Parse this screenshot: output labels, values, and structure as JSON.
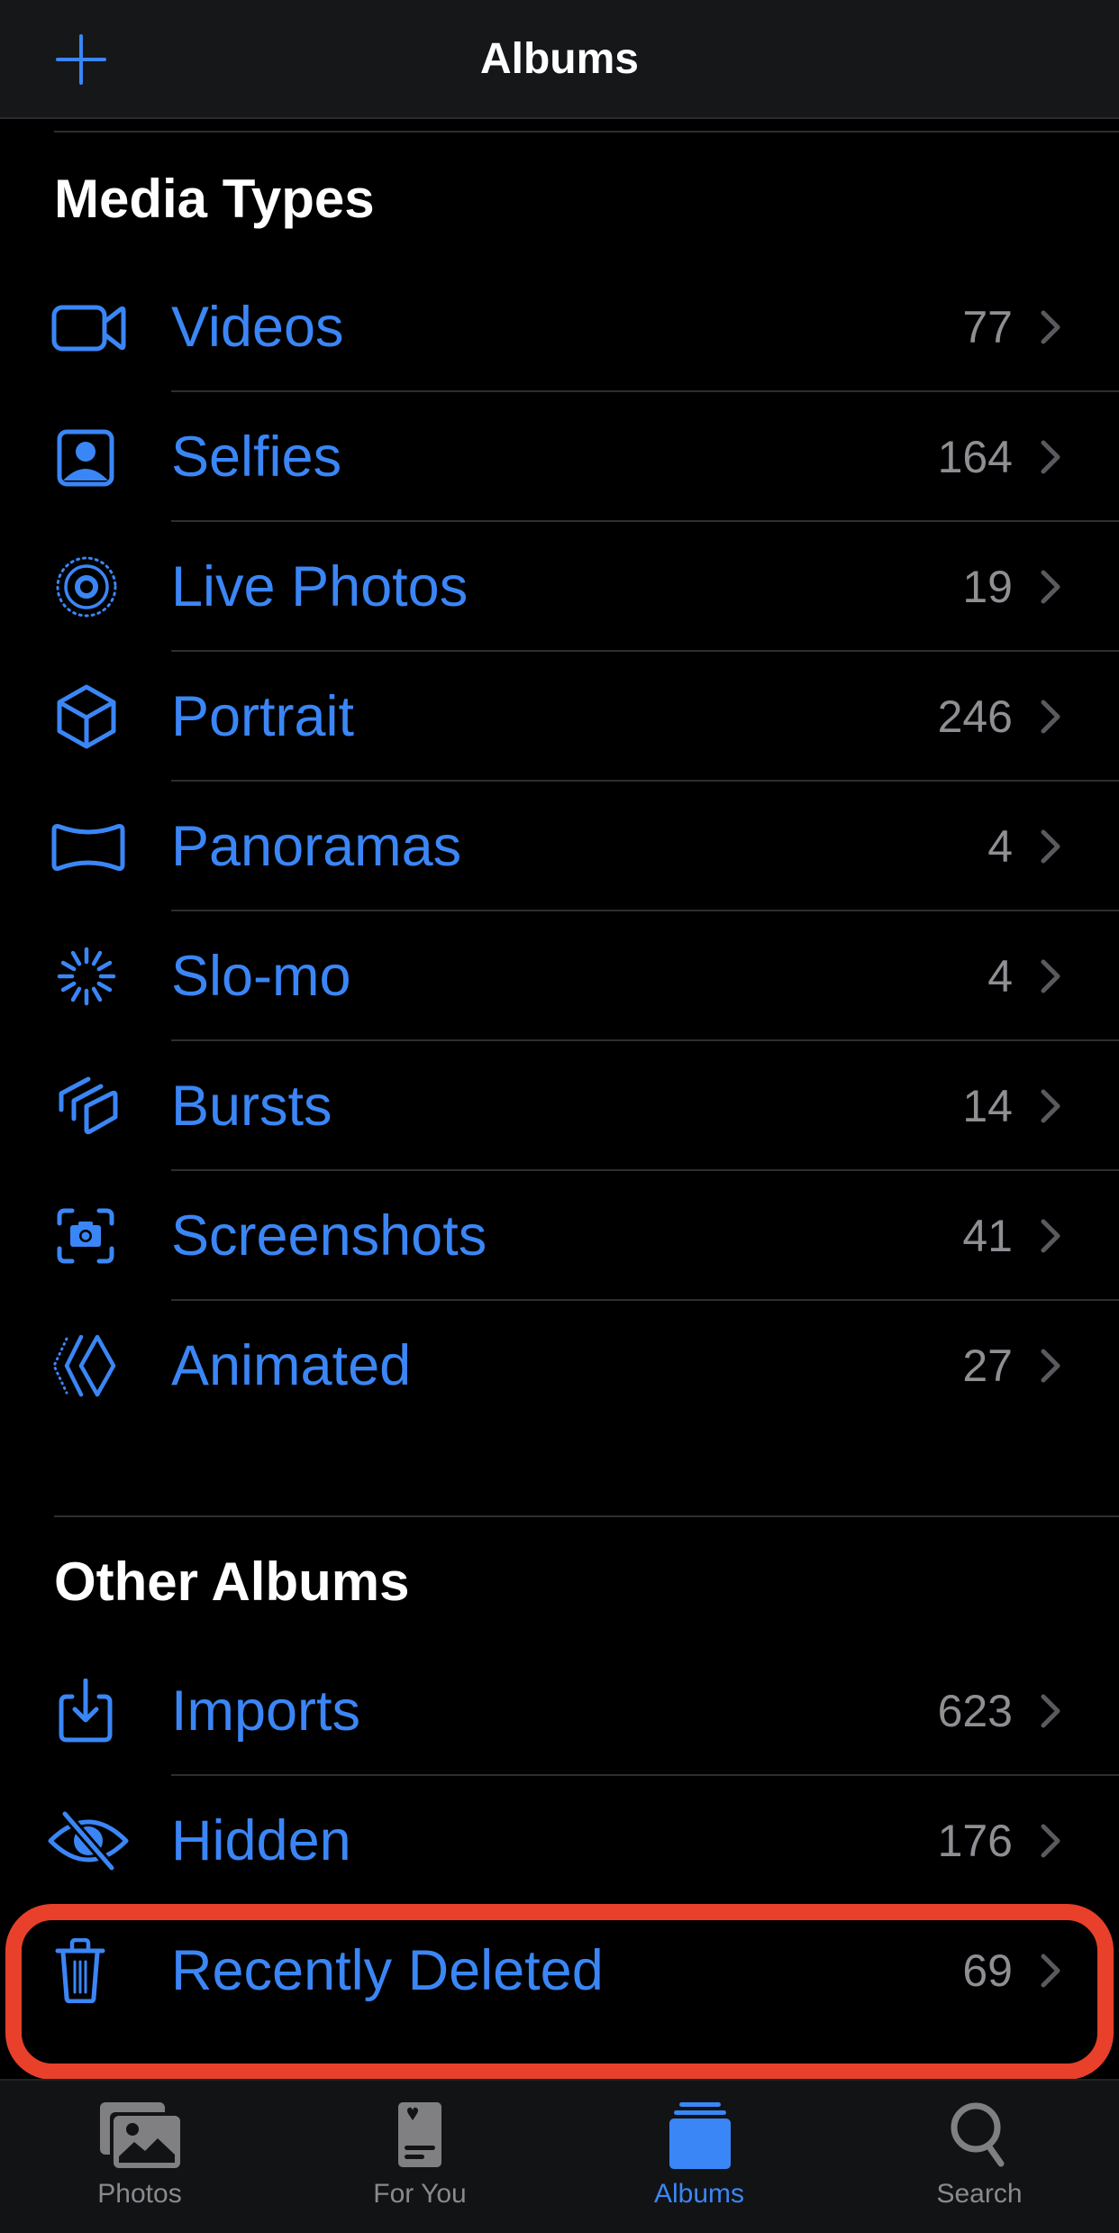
{
  "header": {
    "title": "Albums",
    "add_icon": "plus-icon"
  },
  "colors": {
    "accent": "#3b86f6",
    "count": "#8e8e93",
    "highlight": "#e8402a",
    "tab_inactive": "#8a8a8e"
  },
  "media_types": {
    "title": "Media Types",
    "items": [
      {
        "label": "Videos",
        "count": "77",
        "icon": "video-camera-icon"
      },
      {
        "label": "Selfies",
        "count": "164",
        "icon": "selfie-portrait-icon"
      },
      {
        "label": "Live Photos",
        "count": "19",
        "icon": "live-photo-icon"
      },
      {
        "label": "Portrait",
        "count": "246",
        "icon": "cube-icon"
      },
      {
        "label": "Panoramas",
        "count": "4",
        "icon": "panorama-icon"
      },
      {
        "label": "Slo-mo",
        "count": "4",
        "icon": "slo-mo-icon"
      },
      {
        "label": "Bursts",
        "count": "14",
        "icon": "bursts-icon"
      },
      {
        "label": "Screenshots",
        "count": "41",
        "icon": "screenshot-camera-icon"
      },
      {
        "label": "Animated",
        "count": "27",
        "icon": "animated-diamond-icon"
      }
    ]
  },
  "other_albums": {
    "title": "Other Albums",
    "items": [
      {
        "label": "Imports",
        "count": "623",
        "icon": "import-tray-icon"
      },
      {
        "label": "Hidden",
        "count": "176",
        "icon": "eye-slash-icon"
      },
      {
        "label": "Recently Deleted",
        "count": "69",
        "icon": "trash-icon",
        "highlighted": true
      }
    ]
  },
  "tabbar": {
    "tabs": [
      {
        "label": "Photos",
        "icon": "photos-stack-icon",
        "active": false
      },
      {
        "label": "For You",
        "icon": "for-you-card-icon",
        "active": false
      },
      {
        "label": "Albums",
        "icon": "albums-stack-icon",
        "active": true
      },
      {
        "label": "Search",
        "icon": "magnifier-icon",
        "active": false
      }
    ]
  }
}
